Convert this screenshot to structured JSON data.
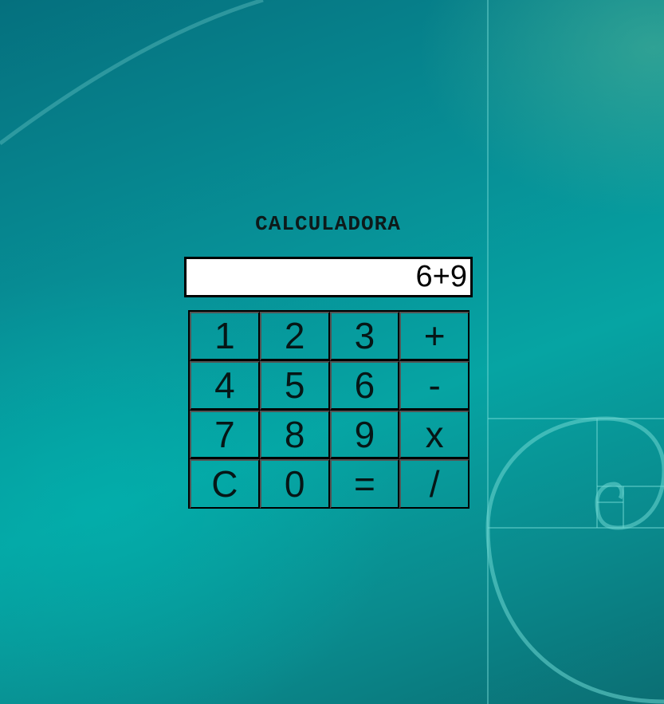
{
  "app": {
    "title": "CALCULADORA"
  },
  "display": {
    "value": "6+9"
  },
  "keys": [
    {
      "label": "1",
      "name": "key-1"
    },
    {
      "label": "2",
      "name": "key-2"
    },
    {
      "label": "3",
      "name": "key-3"
    },
    {
      "label": "+",
      "name": "key-plus"
    },
    {
      "label": "4",
      "name": "key-4"
    },
    {
      "label": "5",
      "name": "key-5"
    },
    {
      "label": "6",
      "name": "key-6"
    },
    {
      "label": "-",
      "name": "key-minus"
    },
    {
      "label": "7",
      "name": "key-7"
    },
    {
      "label": "8",
      "name": "key-8"
    },
    {
      "label": "9",
      "name": "key-9"
    },
    {
      "label": "x",
      "name": "key-multiply"
    },
    {
      "label": "C",
      "name": "key-clear"
    },
    {
      "label": "0",
      "name": "key-0"
    },
    {
      "label": "=",
      "name": "key-equals"
    },
    {
      "label": "/",
      "name": "key-divide"
    }
  ],
  "colors": {
    "background_start": "#05707e",
    "background_mid": "#06a4a3",
    "display_bg": "#ffffff",
    "border": "#000000"
  }
}
